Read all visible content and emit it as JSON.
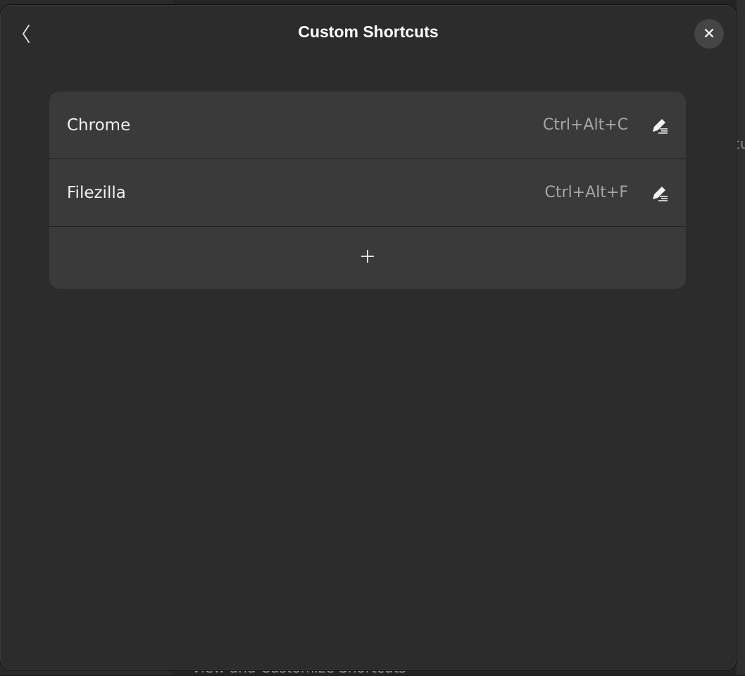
{
  "background": {
    "peek_text": "cu",
    "bottom_text": "View and Customize Shortcuts"
  },
  "dialog": {
    "title": "Custom Shortcuts",
    "back_icon": "chevron-left-icon",
    "close_icon": "close-icon"
  },
  "shortcuts": [
    {
      "name": "Chrome",
      "accelerator": "Ctrl+Alt+C",
      "icon": "edit-icon"
    },
    {
      "name": "Filezilla",
      "accelerator": "Ctrl+Alt+F",
      "icon": "edit-icon"
    }
  ],
  "add_row": {
    "icon": "plus-icon"
  },
  "colors": {
    "dialog_bg": "#2c2c2c",
    "list_bg": "#3a3a3a",
    "close_bg": "#454545",
    "text_primary": "#f0f0f0",
    "text_secondary": "#a6a6a6"
  }
}
